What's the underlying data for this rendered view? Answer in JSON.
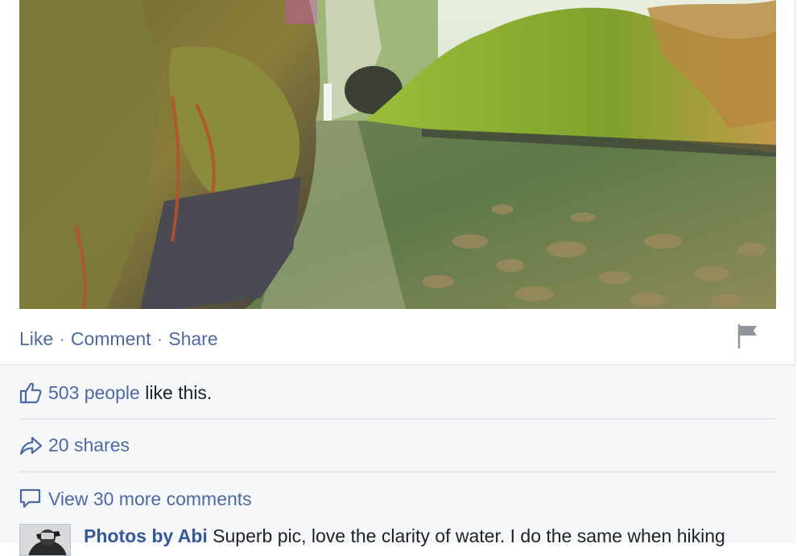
{
  "post": {
    "photo_icon": "landscape-photo-waterfall-canyon",
    "actions": {
      "like": "Like",
      "comment": "Comment",
      "share": "Share",
      "separator": "·"
    },
    "flag_icon": "flag-icon"
  },
  "ufi": {
    "likes": {
      "icon": "thumbs-up-icon",
      "count_text": "503 people",
      "suffix": " like this."
    },
    "shares": {
      "icon": "share-arrow-icon",
      "text": "20 shares"
    },
    "comments": {
      "icon": "speech-bubble-icon",
      "text": "View 30 more comments"
    },
    "first_comment": {
      "author": "Photos by Abi",
      "text": " Superb pic, love the clarity of water. I do the same when hiking"
    }
  },
  "colors": {
    "link": "#4e69a2",
    "author": "#365899",
    "panel_bg": "#f6f7f9",
    "text": "#1d2129"
  }
}
